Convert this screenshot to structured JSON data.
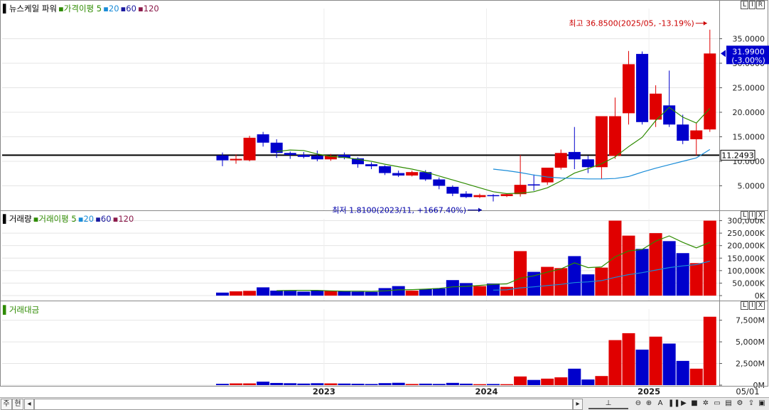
{
  "legends": {
    "price": [
      {
        "text": "뉴스케일 파워",
        "color": "#000000"
      },
      {
        "text": "가격이평 5",
        "color": "#2e8b00"
      },
      {
        "text": "20",
        "color": "#1a8cd8"
      },
      {
        "text": "60",
        "color": "#1a1aa0"
      },
      {
        "text": "120",
        "color": "#8b1a4a"
      }
    ],
    "volume": [
      {
        "text": "거래량",
        "color": "#000000"
      },
      {
        "text": "거래이평 5",
        "color": "#2e8b00"
      },
      {
        "text": "20",
        "color": "#1a8cd8"
      },
      {
        "text": "60",
        "color": "#1a1aa0"
      },
      {
        "text": "120",
        "color": "#8b1a4a"
      }
    ],
    "amount": [
      {
        "text": "거래대금",
        "color": "#2e8b00"
      }
    ]
  },
  "corner_buttons": {
    "price": [
      "L",
      "I",
      "R"
    ],
    "volume": [
      "L",
      "I",
      "X"
    ],
    "amount": [
      "L",
      "I",
      "X"
    ]
  },
  "bottom_bar": {
    "left_tabs": [
      "주",
      "현"
    ],
    "icons": [
      "scroll-left-icon",
      "scroll-right-icon",
      "zoom-slider-icon",
      "zoom-out-icon",
      "zoom-in-icon",
      "text-a-icon",
      "pause-icon",
      "play-icon",
      "stop-icon",
      "window-icon",
      "settings-icon",
      "export-icon"
    ]
  },
  "chart_data": {
    "type": "candlestick",
    "period": "monthly",
    "x_labels": [
      {
        "label": "2023",
        "index": 8
      },
      {
        "label": "2024",
        "index": 20
      },
      {
        "label": "2025",
        "index": 32
      },
      {
        "label": "05/01",
        "index": 37
      }
    ],
    "candles": [
      {
        "o": 11.2,
        "h": 11.8,
        "l": 9.0,
        "c": 10.2
      },
      {
        "o": 10.2,
        "h": 11.4,
        "l": 9.5,
        "c": 10.5
      },
      {
        "o": 10.2,
        "h": 15.2,
        "l": 10.0,
        "c": 14.8
      },
      {
        "o": 15.5,
        "h": 16.0,
        "l": 13.0,
        "c": 13.8
      },
      {
        "o": 13.8,
        "h": 14.5,
        "l": 10.7,
        "c": 11.7
      },
      {
        "o": 11.7,
        "h": 12.0,
        "l": 10.5,
        "c": 11.3
      },
      {
        "o": 11.3,
        "h": 11.9,
        "l": 10.6,
        "c": 10.9
      },
      {
        "o": 11.1,
        "h": 12.2,
        "l": 10.0,
        "c": 10.4
      },
      {
        "o": 10.4,
        "h": 11.5,
        "l": 10.1,
        "c": 11.1
      },
      {
        "o": 11.3,
        "h": 11.8,
        "l": 10.4,
        "c": 10.7
      },
      {
        "o": 10.6,
        "h": 10.8,
        "l": 8.7,
        "c": 9.4
      },
      {
        "o": 9.4,
        "h": 9.8,
        "l": 8.4,
        "c": 9.0
      },
      {
        "o": 9.0,
        "h": 9.2,
        "l": 7.2,
        "c": 7.6
      },
      {
        "o": 7.6,
        "h": 8.1,
        "l": 6.8,
        "c": 7.1
      },
      {
        "o": 7.1,
        "h": 8.1,
        "l": 6.9,
        "c": 7.8
      },
      {
        "o": 7.8,
        "h": 8.2,
        "l": 6.0,
        "c": 6.3
      },
      {
        "o": 6.3,
        "h": 6.7,
        "l": 4.3,
        "c": 5.0
      },
      {
        "o": 4.8,
        "h": 5.1,
        "l": 2.9,
        "c": 3.4
      },
      {
        "o": 3.4,
        "h": 3.9,
        "l": 2.5,
        "c": 2.7
      },
      {
        "o": 2.7,
        "h": 3.4,
        "l": 2.5,
        "c": 3.1
      },
      {
        "o": 3.1,
        "h": 3.3,
        "l": 1.81,
        "c": 2.9
      },
      {
        "o": 2.9,
        "h": 3.4,
        "l": 2.7,
        "c": 3.3
      },
      {
        "o": 3.3,
        "h": 11.3,
        "l": 2.8,
        "c": 5.2
      },
      {
        "o": 5.3,
        "h": 7.3,
        "l": 4.0,
        "c": 5.2
      },
      {
        "o": 5.7,
        "h": 8.3,
        "l": 5.2,
        "c": 8.7
      },
      {
        "o": 8.7,
        "h": 12.4,
        "l": 8.3,
        "c": 11.7
      },
      {
        "o": 11.9,
        "h": 17.0,
        "l": 8.4,
        "c": 10.4
      },
      {
        "o": 10.4,
        "h": 11.1,
        "l": 7.6,
        "c": 8.8
      },
      {
        "o": 8.8,
        "h": 13.7,
        "l": 6.4,
        "c": 19.2
      },
      {
        "o": 11.1,
        "h": 23.0,
        "l": 10.5,
        "c": 19.2
      },
      {
        "o": 19.8,
        "h": 32.5,
        "l": 17.5,
        "c": 29.8
      },
      {
        "o": 31.9,
        "h": 32.4,
        "l": 17.5,
        "c": 18.0
      },
      {
        "o": 18.5,
        "h": 25.5,
        "l": 17.0,
        "c": 23.8
      },
      {
        "o": 21.4,
        "h": 28.5,
        "l": 17.0,
        "c": 17.5
      },
      {
        "o": 17.5,
        "h": 19.5,
        "l": 13.5,
        "c": 14.2
      },
      {
        "o": 14.5,
        "h": 17.8,
        "l": 11.2,
        "c": 16.3
      },
      {
        "o": 16.5,
        "h": 36.85,
        "l": 16.0,
        "c": 31.99
      }
    ],
    "up_color": "#e00000",
    "down_color": "#0000cc",
    "y_axis": {
      "ticks": [
        5,
        10,
        15,
        20,
        25,
        30,
        35
      ],
      "labels": [
        "5.0000",
        "10.0000",
        "15.0000",
        "20.0000",
        "25.0000",
        "30.0000",
        "35.0000"
      ],
      "ylim": [
        0,
        40
      ]
    },
    "ma5": [
      null,
      null,
      null,
      null,
      12.0,
      12.3,
      12.2,
      11.5,
      11.0,
      10.8,
      10.4,
      10.0,
      9.4,
      8.9,
      8.4,
      7.8,
      7.0,
      6.2,
      5.4,
      4.6,
      3.8,
      3.4,
      3.5,
      3.8,
      4.6,
      6.0,
      7.6,
      8.5,
      9.5,
      10.9,
      13.0,
      14.9,
      18.3,
      21.0,
      19.0,
      17.8,
      20.8
    ],
    "ma20": [
      null,
      null,
      null,
      null,
      null,
      null,
      null,
      null,
      null,
      null,
      null,
      null,
      null,
      null,
      null,
      null,
      null,
      null,
      null,
      null,
      8.4,
      8.1,
      7.7,
      7.2,
      6.8,
      6.6,
      6.5,
      6.4,
      6.4,
      6.5,
      6.9,
      7.8,
      8.6,
      9.3,
      10.0,
      10.7,
      12.4
    ],
    "current_price": {
      "text": "31.9900",
      "change": "(-3.00%)",
      "value": 31.99,
      "bg": "#0000cc"
    },
    "reference_line": {
      "value": 11.2493,
      "text": "11.2493"
    },
    "annotation_high": {
      "text": "최고 36.8500(2025/05, -13.19%)",
      "value": 36.85,
      "index": 36,
      "color": "#cc0000"
    },
    "annotation_low": {
      "text": "최저 1.8100(2023/11, +1667.40%)",
      "value": 1.81,
      "index": 20,
      "color": "#0000aa"
    },
    "volume": {
      "values": [
        12000,
        17000,
        19000,
        33000,
        20000,
        19000,
        16000,
        20000,
        19000,
        17000,
        16000,
        15000,
        30000,
        38000,
        20000,
        26000,
        29000,
        62000,
        50000,
        38000,
        48000,
        35000,
        178000,
        95000,
        115000,
        110000,
        158000,
        85000,
        112000,
        300000,
        240000,
        187000,
        250000,
        218000,
        170000,
        130000,
        300000
      ],
      "ma5": [
        null,
        null,
        null,
        null,
        20000,
        21000,
        21000,
        21000,
        19000,
        18000,
        18000,
        17000,
        19000,
        23000,
        24000,
        26000,
        29000,
        35000,
        37000,
        41000,
        45000,
        47000,
        70000,
        79000,
        94000,
        107000,
        131000,
        112000,
        115000,
        155000,
        179000,
        185000,
        218000,
        239000,
        213000,
        191000,
        213000
      ],
      "ma20": [
        null,
        null,
        null,
        null,
        null,
        null,
        null,
        null,
        null,
        null,
        null,
        null,
        null,
        null,
        null,
        null,
        null,
        null,
        null,
        null,
        22000,
        23000,
        31000,
        35000,
        40000,
        45000,
        52000,
        55000,
        60000,
        73000,
        84000,
        92000,
        102000,
        112000,
        119000,
        124000,
        138000
      ],
      "y_axis": {
        "ticks": [
          0,
          50000,
          100000,
          150000,
          200000,
          250000,
          300000
        ],
        "labels": [
          "0K",
          "50,000K",
          "100,000K",
          "150,000K",
          "200,000K",
          "250,000K",
          "300,000K"
        ],
        "ylim": [
          0,
          310000
        ]
      }
    },
    "amount": {
      "values": [
        150,
        200,
        200,
        400,
        250,
        220,
        180,
        220,
        200,
        180,
        160,
        130,
        230,
        270,
        130,
        170,
        140,
        260,
        170,
        110,
        130,
        110,
        1000,
        600,
        750,
        900,
        1900,
        650,
        1050,
        5200,
        6000,
        4100,
        5600,
        4800,
        2800,
        1900,
        7900
      ],
      "y_axis": {
        "ticks": [
          0,
          2500,
          5000,
          7500
        ],
        "labels": [
          "0M",
          "2,500M",
          "5,000M",
          "7,500M"
        ],
        "ylim": [
          0,
          8700
        ]
      }
    }
  }
}
